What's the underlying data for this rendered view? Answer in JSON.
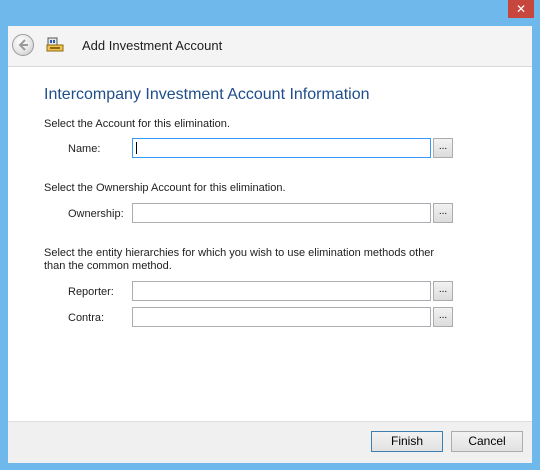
{
  "window": {
    "close_glyph": "✕"
  },
  "header": {
    "title": "Add Investment Account"
  },
  "main": {
    "section_title": "Intercompany Investment Account Information",
    "account_instruction": "Select the Account for this elimination.",
    "name_label": "Name:",
    "name_value": "",
    "ownership_instruction": "Select the Ownership Account for this elimination.",
    "ownership_label": "Ownership:",
    "ownership_value": "",
    "hierarchy_instruction": "Select the entity hierarchies for which you wish to use elimination methods other than the common method.",
    "reporter_label": "Reporter:",
    "reporter_value": "",
    "contra_label": "Contra:",
    "contra_value": "",
    "browse_label": "..."
  },
  "footer": {
    "finish_label": "Finish",
    "cancel_label": "Cancel"
  },
  "colors": {
    "title_bar": "#6fb8ec",
    "close_button": "#c7463e",
    "section_title": "#1f4e8c"
  }
}
